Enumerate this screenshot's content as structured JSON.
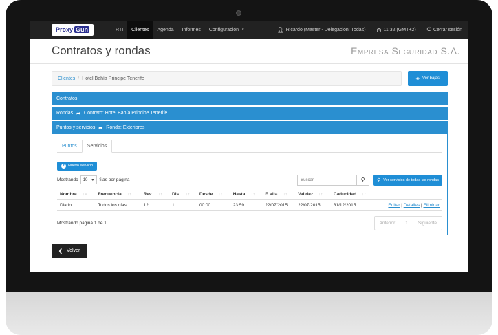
{
  "brand": {
    "logo_part1": "Proxy",
    "logo_part2": "Gun"
  },
  "nav": {
    "items": [
      "RTI",
      "Clientes",
      "Agenda",
      "Informes",
      "Configuración"
    ],
    "user": "Ricardo (Master - Delegación: Todas)",
    "time": "11:32 (GMT+2)",
    "logout": "Cerrar sesión"
  },
  "header": {
    "title": "Contratos y rondas",
    "company": "Empresa Seguridad S.A."
  },
  "breadcrumb": {
    "root": "Clientes",
    "current": "Hotel Bahía Principe Tenerife"
  },
  "buttons": {
    "ver_bajas": "Ver bajas",
    "nuevo_servicio": "Nuevo servicio",
    "ver_todas": "Ver servicios de todas las rondas",
    "volver": "Volver"
  },
  "panels": {
    "contratos": "Contratos",
    "rondas_label": "Rondas",
    "rondas_detail": "Contrato: Hotel Bahía Principe Tenerife",
    "puntos_label": "Puntos y servicios",
    "puntos_detail": "Ronda: Exteriores"
  },
  "tabs": [
    "Puntos",
    "Servicios"
  ],
  "controls": {
    "mostrando": "Mostrando",
    "rows": "10",
    "filas": "filas por página",
    "search_placeholder": "Buscar"
  },
  "table": {
    "headers": [
      "Nombre",
      "Frecuencia",
      "Rev.",
      "Dis.",
      "Desde",
      "Hasta",
      "F. alta",
      "Validez",
      "Caducidad"
    ],
    "rows": [
      {
        "cells": [
          "Diario",
          "Todos los días",
          "12",
          "1",
          "00:00",
          "23:59",
          "22/07/2015",
          "22/07/2015",
          "31/12/2015"
        ],
        "actions": {
          "editar": "Editar",
          "detalles": "Detalles",
          "eliminar": "Eliminar"
        }
      }
    ]
  },
  "pagination": {
    "info": "Mostrando página 1 de 1",
    "prev": "Anterior",
    "page": "1",
    "next": "Siguiente"
  },
  "colors": {
    "accent": "#2a8fd0",
    "navbar": "#222222",
    "button": "#1f8ed6"
  },
  "icons": {
    "user": "user-icon",
    "clock": "clock-icon",
    "power": "power-icon",
    "eye_slash": "eye-slash-icon",
    "search": "search-icon",
    "arrow": "share-arrow-icon",
    "chevron": "chevron-left-icon",
    "plus": "plus-circle-icon"
  }
}
